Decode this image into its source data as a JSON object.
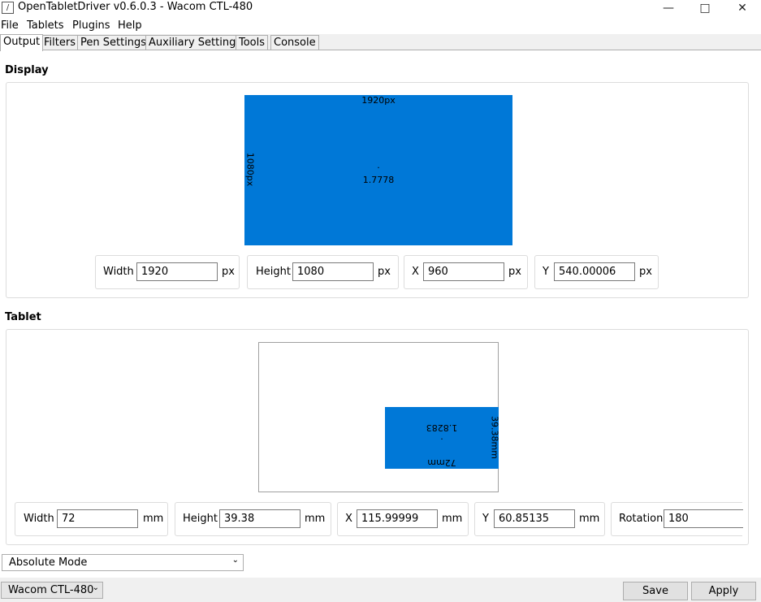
{
  "window": {
    "title": "OpenTabletDriver v0.6.0.3 - Wacom CTL-480",
    "icon": "app-icon",
    "controls": [
      "minimize-icon",
      "maximize-icon",
      "close-icon"
    ]
  },
  "menu": [
    "File",
    "Tablets",
    "Plugins",
    "Help"
  ],
  "tabs": [
    "Output",
    "Filters",
    "Pen Settings",
    "Auxiliary Settings",
    "Tools",
    "Console"
  ],
  "display": {
    "section_title": "Display",
    "area_width_label": "1920px",
    "area_height_label": "1080px",
    "ratio": "1.7778",
    "center_dot": ".",
    "fields": {
      "width_label": "Width",
      "width_value": "1920",
      "width_unit": "px",
      "height_label": "Height",
      "height_value": "1080",
      "height_unit": "px",
      "x_label": "X",
      "x_value": "960",
      "x_unit": "px",
      "y_label": "Y",
      "y_value": "540.00006",
      "y_unit": "px"
    }
  },
  "tablet": {
    "section_title": "Tablet",
    "area_width_label": "72mm",
    "area_height_label": "39.38mm",
    "ratio": "1.8283",
    "center_dot": ".",
    "rotation_deg": 180,
    "fields": {
      "width_label": "Width",
      "width_value": "72",
      "width_unit": "mm",
      "height_label": "Height",
      "height_value": "39.38",
      "height_unit": "mm",
      "x_label": "X",
      "x_value": "115.99999",
      "x_unit": "mm",
      "y_label": "Y",
      "y_value": "60.85135",
      "y_unit": "mm",
      "rotation_label": "Rotation",
      "rotation_value": "180"
    }
  },
  "mode_select": {
    "value": "Absolute Mode",
    "icon": "chevron-down-icon"
  },
  "footer": {
    "tablet_select": "Wacom CTL-480",
    "save_label": "Save",
    "apply_label": "Apply"
  },
  "colors": {
    "area_fill": "#0078d7",
    "window_bg": "#f0f0f0"
  }
}
